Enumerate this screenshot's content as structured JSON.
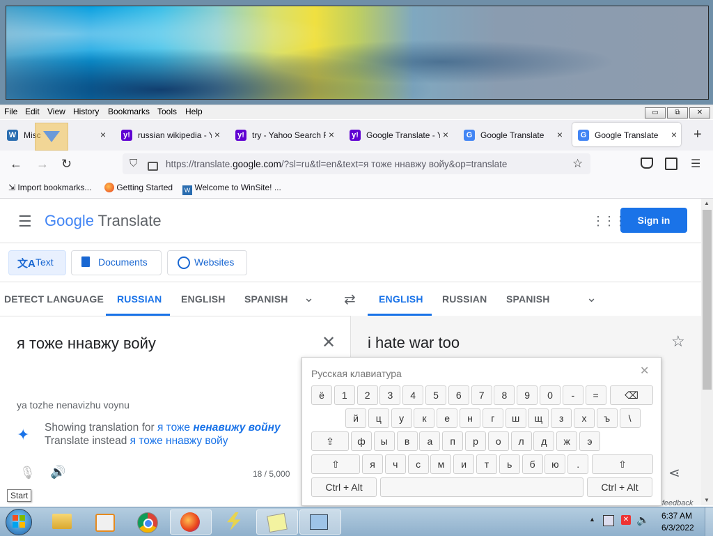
{
  "menubar": [
    "File",
    "Edit",
    "View",
    "History",
    "Bookmarks",
    "Tools",
    "Help"
  ],
  "window_controls": {
    "minimize": "▭",
    "restore": "⧉",
    "close": "✕"
  },
  "tabs": [
    {
      "title": "Misc",
      "favicon": "winsite-icon"
    },
    {
      "title": "russian wikipedia - Y",
      "favicon": "yahoo-icon"
    },
    {
      "title": "try - Yahoo Search R",
      "favicon": "yahoo-icon"
    },
    {
      "title": "Google Translate - Y",
      "favicon": "yahoo-icon"
    },
    {
      "title": "Google Translate",
      "favicon": "google-translate-icon"
    },
    {
      "title": "Google Translate",
      "favicon": "google-translate-icon",
      "active": true
    }
  ],
  "url": {
    "prefix": "https://translate.",
    "domain": "google.com",
    "rest": "/?sl=ru&tl=en&text=я тоже ннавжу войу&op=translate"
  },
  "bookmarks": [
    "Import bookmarks...",
    "Getting Started",
    "Welcome to WinSite! ..."
  ],
  "gt": {
    "brand_google": "Google",
    "brand_translate": "Translate",
    "signin": "Sign in",
    "tools": [
      "Text",
      "Documents",
      "Websites"
    ],
    "source_langs": [
      "DETECT LANGUAGE",
      "RUSSIAN",
      "ENGLISH",
      "SPANISH"
    ],
    "target_langs": [
      "ENGLISH",
      "RUSSIAN",
      "SPANISH"
    ],
    "source_text": "я тоже ннавжу войу",
    "transliteration": "ya tozhe nenavizhu voynu",
    "showing_prefix": "Showing translation for",
    "showing_plain": "я тоже",
    "showing_bold": "ненавижу войну",
    "instead_prefix": "Translate instead",
    "instead_text": "я тоже ннавжу войу",
    "char_count": "18 / 5,000",
    "translation": "i hate war too",
    "send_feedback": "Send feedback"
  },
  "keyboard": {
    "title": "Русская клавиатура",
    "row1": [
      "ё",
      "1",
      "2",
      "3",
      "4",
      "5",
      "6",
      "7",
      "8",
      "9",
      "0",
      "-",
      "="
    ],
    "row2": [
      "й",
      "ц",
      "у",
      "к",
      "е",
      "н",
      "г",
      "ш",
      "щ",
      "з",
      "х",
      "ъ",
      "\\"
    ],
    "row3": [
      "ф",
      "ы",
      "в",
      "а",
      "п",
      "р",
      "о",
      "л",
      "д",
      "ж",
      "э"
    ],
    "row4": [
      "я",
      "ч",
      "с",
      "м",
      "и",
      "т",
      "ь",
      "б",
      "ю",
      "."
    ],
    "ctrl_alt": "Ctrl + Alt"
  },
  "tooltip": "Start",
  "taskbar": {
    "time": "6:37 AM",
    "date": "6/3/2022"
  }
}
